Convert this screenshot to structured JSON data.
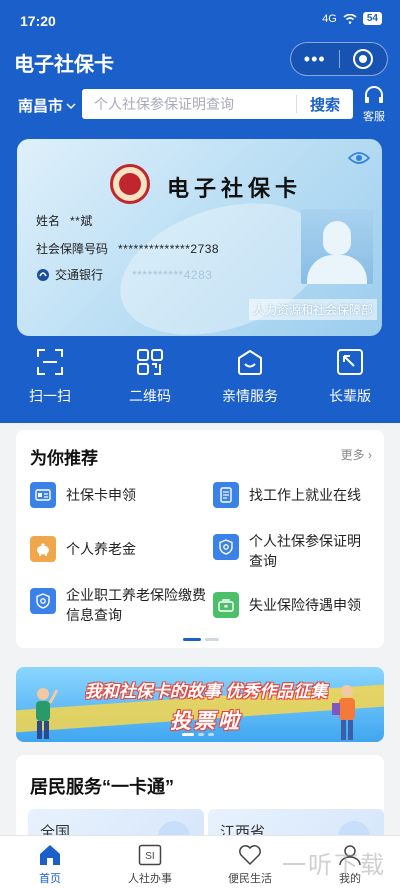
{
  "status": {
    "time": "17:20",
    "network": "4G",
    "battery": "54"
  },
  "header": {
    "title": "电子社保卡",
    "menu_icon": "more-dots-icon",
    "close_icon": "target-icon"
  },
  "search": {
    "city": "南昌市",
    "placeholder": "个人社保参保证明查询",
    "button": "搜索",
    "service_label": "客服"
  },
  "card": {
    "title": "电子社保卡",
    "name_label": "姓名",
    "name_value": "**斌",
    "id_label": "社会保障号码",
    "id_value": "**************2738",
    "bank_name": "交通银行",
    "bank_number": "**********4283",
    "issuer": "人力资源和社会保障部"
  },
  "quick_actions": [
    {
      "label": "扫一扫",
      "icon": "scan-icon"
    },
    {
      "label": "二维码",
      "icon": "qrcode-icon"
    },
    {
      "label": "亲情服务",
      "icon": "family-service-icon"
    },
    {
      "label": "长辈版",
      "icon": "elder-mode-icon"
    }
  ],
  "recommend": {
    "title": "为你推荐",
    "more": "更多",
    "items": [
      {
        "label": "社保卡申领",
        "color": "#3b82e8"
      },
      {
        "label": "找工作上就业在线",
        "color": "#3b82e8"
      },
      {
        "label": "个人养老金",
        "color": "#f0a64a"
      },
      {
        "label": "个人社保参保证明查询",
        "color": "#3b82e8"
      },
      {
        "label": "企业职工养老保险缴费信息查询",
        "color": "#3b82e8"
      },
      {
        "label": "失业保险待遇申领",
        "color": "#4cbf6b"
      }
    ]
  },
  "banner": {
    "line1": "我和社保卡的故事 优秀作品征集",
    "line2": "投票啦"
  },
  "residents": {
    "title": "居民服务“一卡通”",
    "cards": [
      "全国",
      "江西省"
    ]
  },
  "tabs": [
    {
      "label": "首页",
      "icon": "home-icon"
    },
    {
      "label": "人社办事",
      "icon": "si-icon"
    },
    {
      "label": "便民生活",
      "icon": "heart-icon"
    },
    {
      "label": "我的",
      "icon": "user-icon"
    }
  ],
  "watermark": "一听下载",
  "colors": {
    "primary": "#1b5fcb",
    "background": "#f2f3f5"
  }
}
